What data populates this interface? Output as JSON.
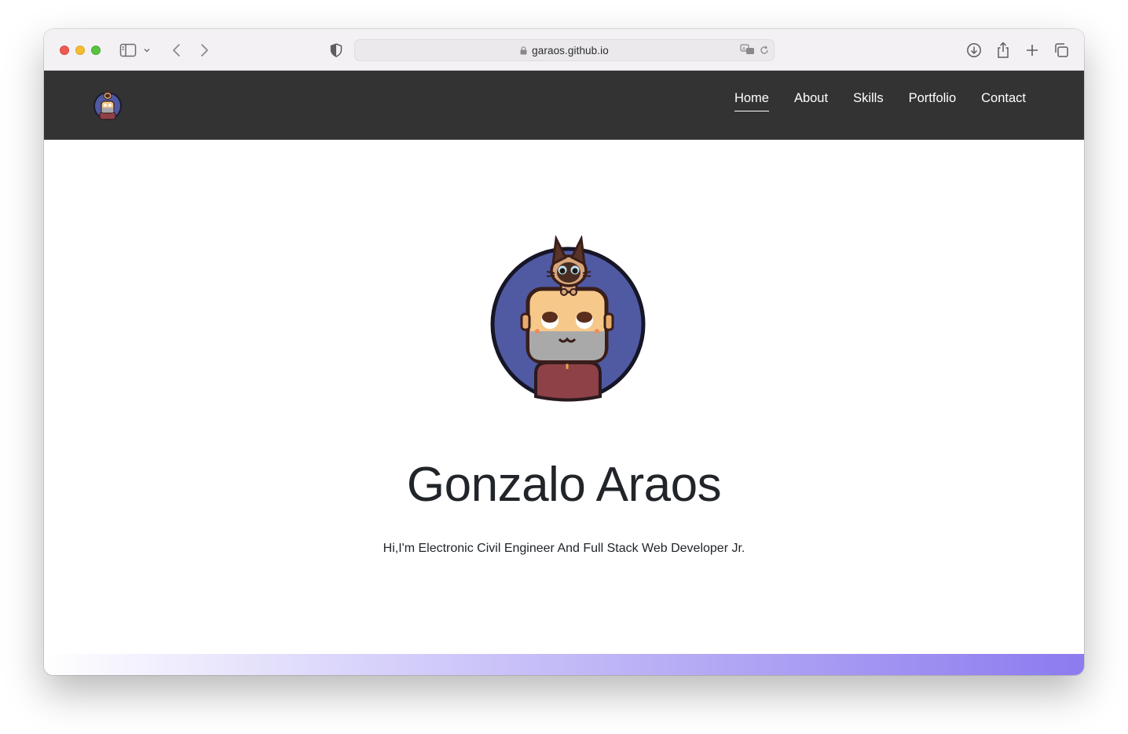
{
  "browser": {
    "url": "garaos.github.io",
    "icons": [
      "sidebar-icon",
      "chevron-down-icon",
      "back-icon",
      "forward-icon",
      "privacy-shield-icon",
      "lock-icon",
      "translate-icon",
      "reload-icon",
      "download-icon",
      "share-icon",
      "new-tab-icon",
      "tab-overview-icon"
    ]
  },
  "nav": {
    "links": [
      {
        "label": "Home",
        "active": true
      },
      {
        "label": "About",
        "active": false
      },
      {
        "label": "Skills",
        "active": false
      },
      {
        "label": "Portfolio",
        "active": false
      },
      {
        "label": "Contact",
        "active": false
      }
    ]
  },
  "hero": {
    "title": "Gonzalo Araos",
    "subtitle": "Hi,I'm Electronic Civil Engineer And Full Stack Web Developer Jr."
  },
  "colors": {
    "navbar": "#333333",
    "avatar_circle": "#4f5aa3",
    "gradient_end": "#8b7bef"
  }
}
